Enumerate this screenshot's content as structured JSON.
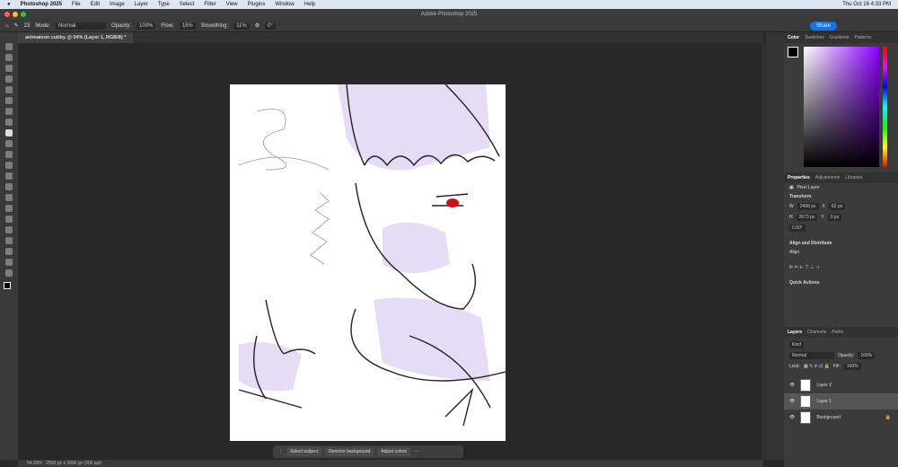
{
  "menubar": {
    "app": "Photoshop 2025",
    "items": [
      "File",
      "Edit",
      "Image",
      "Layer",
      "Type",
      "Select",
      "Filter",
      "View",
      "Plugins",
      "Window",
      "Help"
    ],
    "clock": "Thu Oct 16  4:33 PM"
  },
  "window": {
    "title": "Adobe Photoshop 2025"
  },
  "options": {
    "mode_label": "Mode:",
    "mode": "Normal",
    "opacity_label": "Opacity:",
    "opacity": "100%",
    "flow_label": "Flow:",
    "flow": "15%",
    "smoothing_label": "Smoothing:",
    "smoothing": "11%",
    "angle": "0°",
    "brush_size": "23",
    "share": "Share"
  },
  "document": {
    "tab": "animaison cubby @ 54% (Layer 1, RGB/8) *"
  },
  "color_panel": {
    "tabs": [
      "Color",
      "Swatches",
      "Gradients",
      "Patterns"
    ]
  },
  "properties": {
    "tabs": [
      "Properties",
      "Adjustments",
      "Libraries"
    ],
    "kind": "Pixel Layer",
    "transform_label": "Transform",
    "w": "2408 px",
    "x": "62 px",
    "h": "2673 px",
    "y": "0 px",
    "angle": "0.00°",
    "align_label": "Align and Distribute",
    "align": "Align",
    "quick_actions": "Quick Actions"
  },
  "layers": {
    "tabs": [
      "Layers",
      "Channels",
      "Paths"
    ],
    "filter": "Kind",
    "blend": "Normal",
    "opacity_label": "Opacity:",
    "opacity": "100%",
    "lock_label": "Lock:",
    "fill_label": "Fill:",
    "fill": "100%",
    "items": [
      {
        "name": "Layer 2"
      },
      {
        "name": "Layer 1",
        "selected": true
      },
      {
        "name": "Background"
      }
    ]
  },
  "context_bar": {
    "select_subject": "Select subject",
    "remove_background": "Remove background",
    "adjust_colors": "Adjust colors"
  },
  "status": {
    "zoom": "54.03%",
    "size": "2550 px x 3300 px (300 ppi)"
  },
  "colors": {
    "accent": "#1473e6",
    "sketch_fill": "#e6dcf5",
    "eye": "#d01010"
  }
}
